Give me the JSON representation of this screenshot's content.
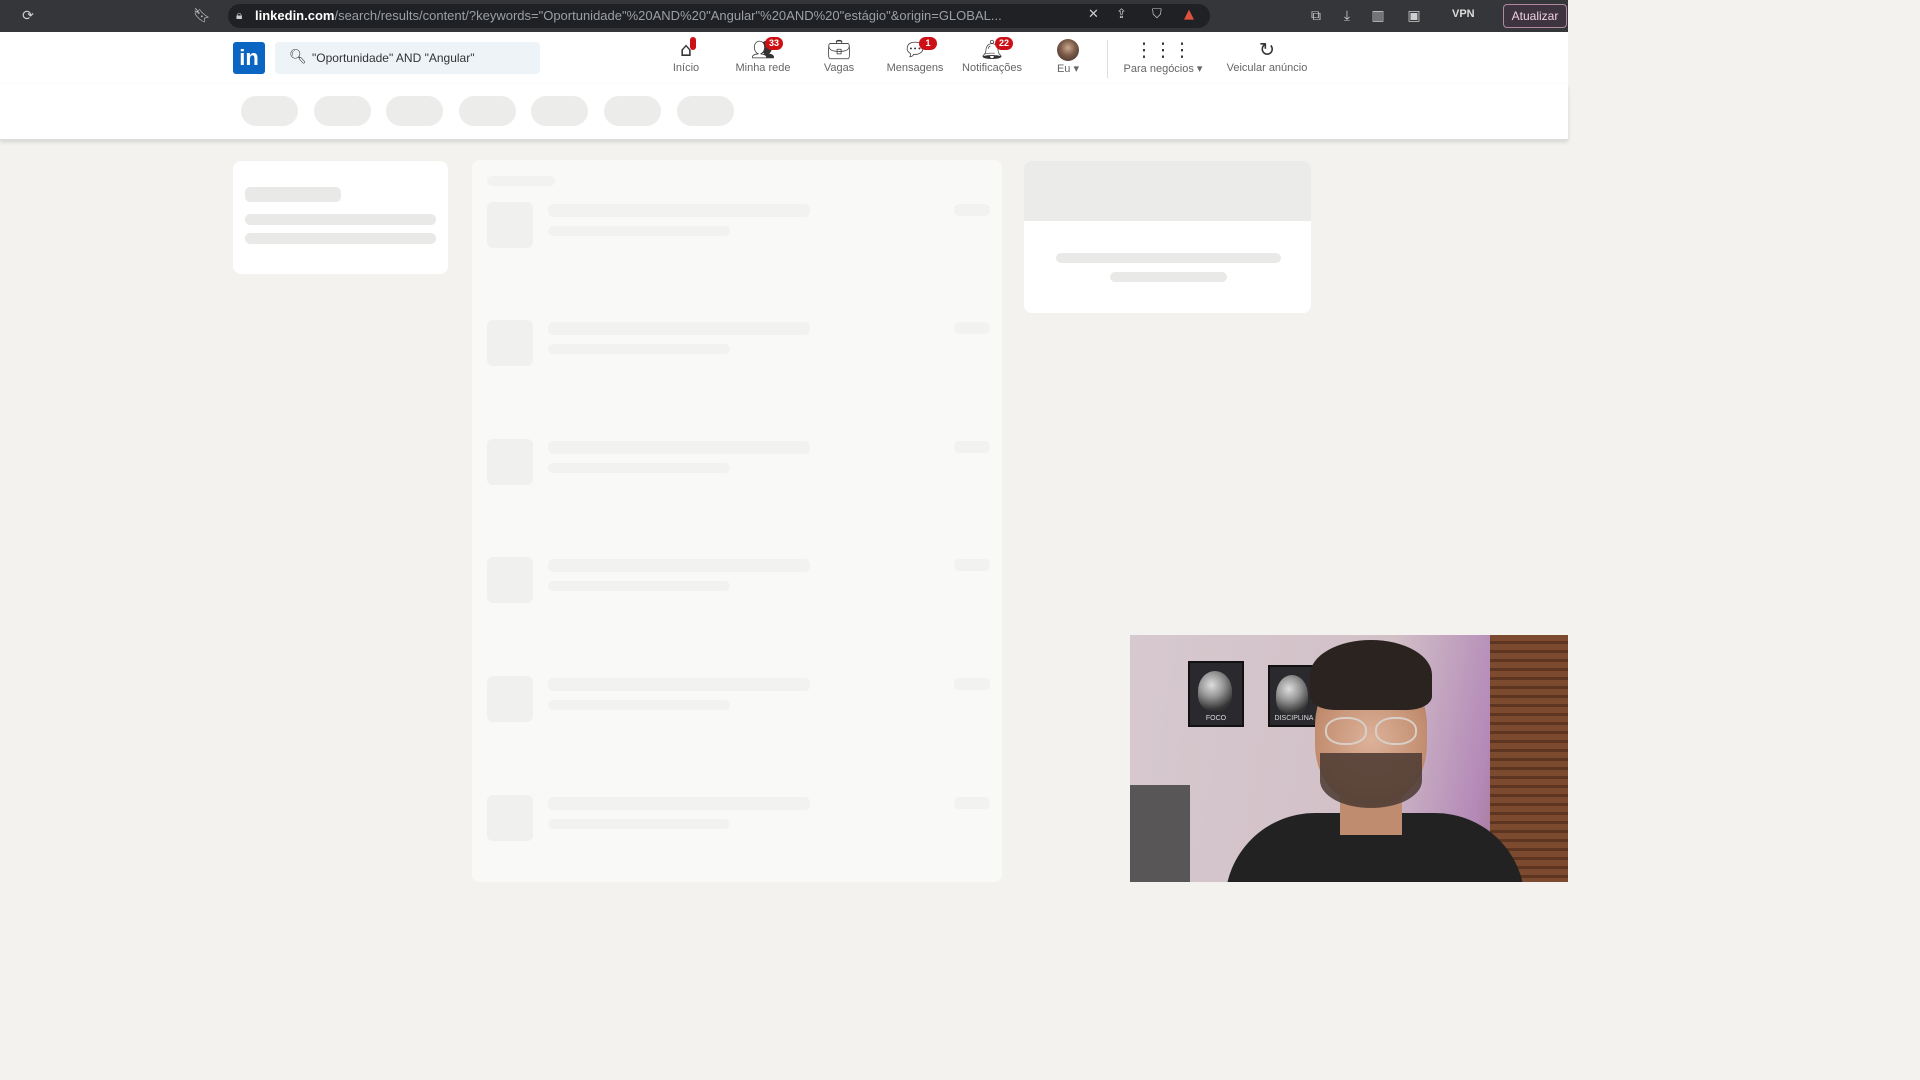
{
  "browser": {
    "url_host": "linkedin.com",
    "url_path": "/search/results/content/?keywords=\"Oportunidade\"%20AND%20\"Angular\"%20AND%20\"estágio\"&origin=GLOBAL...",
    "vpn_label": "VPN",
    "update_label": "Atualizar"
  },
  "header": {
    "search_value": "\"Oportunidade\" AND \"Angular\"",
    "nav": [
      {
        "label": "Início",
        "icon": "home-icon",
        "badge": ""
      },
      {
        "label": "Minha rede",
        "icon": "network-icon",
        "badge": "33"
      },
      {
        "label": "Vagas",
        "icon": "briefcase-icon",
        "badge": ""
      },
      {
        "label": "Mensagens",
        "icon": "messages-icon",
        "badge": "1"
      },
      {
        "label": "Notificações",
        "icon": "bell-icon",
        "badge": "22"
      },
      {
        "label": "Eu ▾",
        "icon": "avatar",
        "badge": ""
      },
      {
        "label": "Para negócios ▾",
        "icon": "grid-icon",
        "badge": ""
      },
      {
        "label": "Veicular anúncio",
        "icon": "ad-icon",
        "badge": ""
      }
    ]
  },
  "colors": {
    "linkedin_blue": "#0a66c2",
    "badge_red": "#cc1016",
    "page_bg": "#f3f2ef"
  }
}
